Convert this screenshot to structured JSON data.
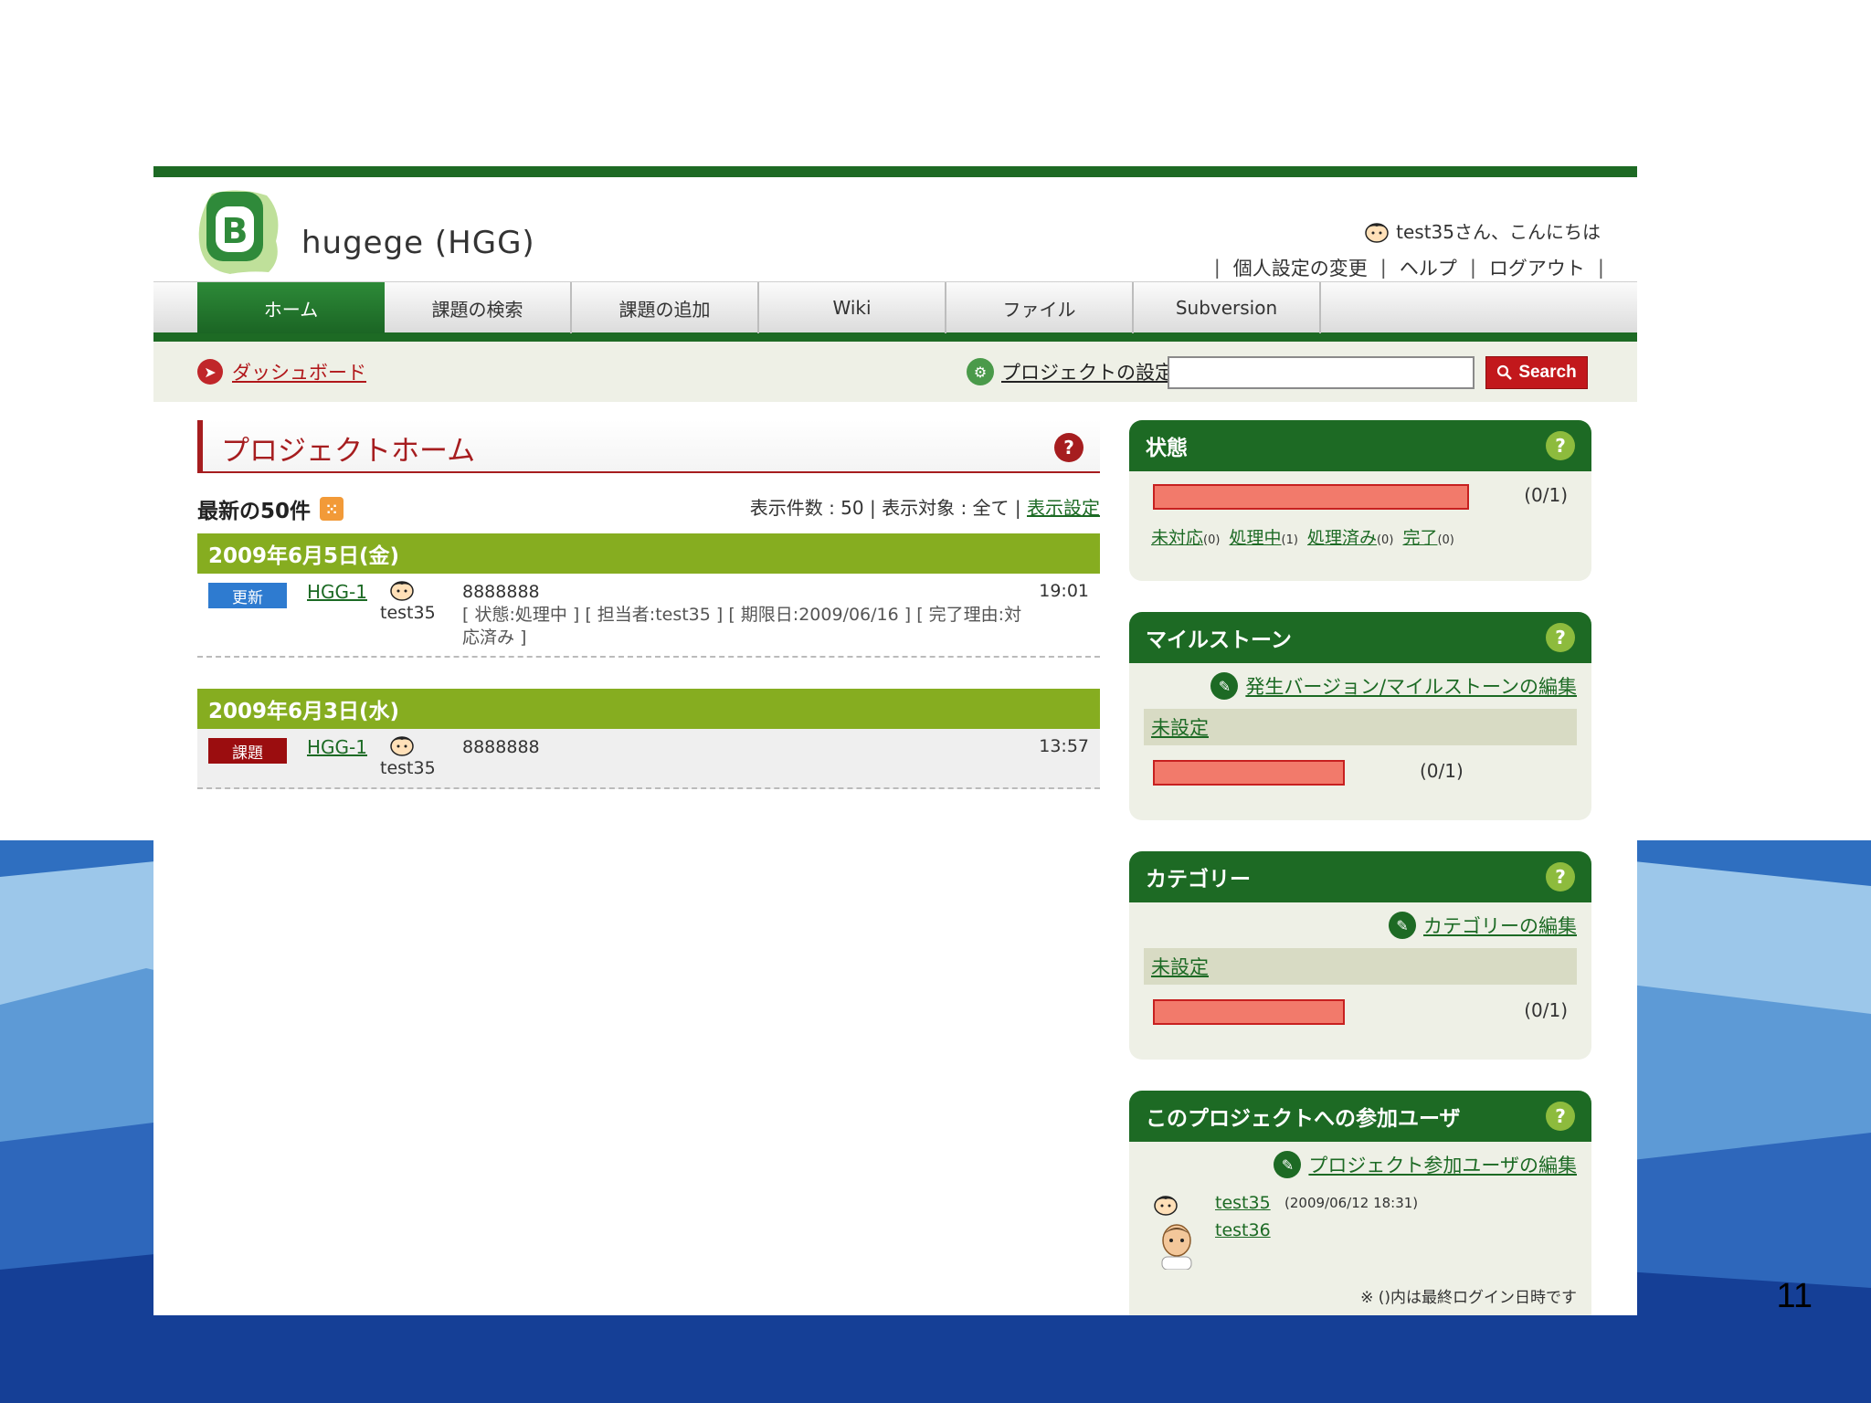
{
  "slide": {
    "number": "11"
  },
  "header": {
    "project_title": "hugege (HGG)",
    "greeting": "test35さん、こんにちは",
    "links": [
      "個人設定の変更",
      "ヘルプ",
      "ログアウト"
    ]
  },
  "nav": {
    "tabs": [
      {
        "label": "ホーム",
        "active": true
      },
      {
        "label": "課題の検索",
        "active": false
      },
      {
        "label": "課題の追加",
        "active": false
      },
      {
        "label": "Wiki",
        "active": false
      },
      {
        "label": "ファイル",
        "active": false
      },
      {
        "label": "Subversion",
        "active": false
      }
    ]
  },
  "toolbar": {
    "dashboard": "ダッシュボード",
    "project_settings": "プロジェクトの設定",
    "search_value": "",
    "search_button": "Search"
  },
  "main": {
    "page_title": "プロジェクトホーム",
    "latest_title": "最新の50件",
    "display_count": "表示件数 : 50 | 表示対象 : 全て | ",
    "display_settings_link": "表示設定",
    "days": [
      {
        "date": "2009年6月5日(金)",
        "entry": {
          "badge": "更新",
          "issue": "HGG-1",
          "user": "test35",
          "summary": "8888888",
          "detail": "[ 状態:処理中 ] [ 担当者:test35 ] [ 期限日:2009/06/16 ] [ 完了理由:対応済み ]",
          "time": "19:01"
        }
      },
      {
        "date": "2009年6月3日(水)",
        "entry": {
          "badge": "課題",
          "issue": "HGG-1",
          "user": "test35",
          "summary": "8888888",
          "detail": "",
          "time": "13:57"
        }
      }
    ]
  },
  "sidebar": {
    "status": {
      "title": "状態",
      "count": "(0/1)",
      "progress": 0,
      "links": [
        {
          "label": "未対応",
          "count": "(0)"
        },
        {
          "label": "処理中",
          "count": "(1)"
        },
        {
          "label": "処理済み",
          "count": "(0)"
        },
        {
          "label": "完了",
          "count": "(0)"
        }
      ]
    },
    "milestone": {
      "title": "マイルストーン",
      "edit_link": "発生バージョン/マイルストーンの編集",
      "unset": "未設定",
      "count": "(0/1)",
      "progress": 0
    },
    "category": {
      "title": "カテゴリー",
      "edit_link": "カテゴリーの編集",
      "unset": "未設定",
      "count": "(0/1)",
      "progress": 0
    },
    "members": {
      "title": "このプロジェクトへの参加ユーザ",
      "edit_link": "プロジェクト参加ユーザの編集",
      "users": [
        {
          "name": "test35",
          "last_login": "(2009/06/12 18:31)"
        },
        {
          "name": "test36",
          "last_login": ""
        }
      ],
      "footnote": "※ ()内は最終ログイン日時です"
    }
  },
  "colors": {
    "brand_green": "#1d6a24",
    "date_bar_green": "#86ad20",
    "accent_red": "#a61d1f",
    "progress_red": "#f27a6b"
  }
}
